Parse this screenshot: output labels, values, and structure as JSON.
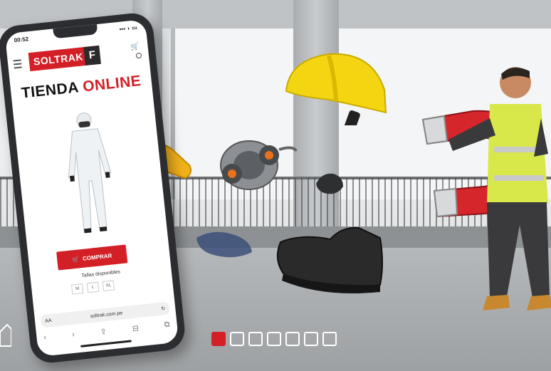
{
  "phone": {
    "time": "00:52",
    "signal": "▪▪▪ ◗ ▭",
    "brand": "SOLTRAK",
    "brand_mark": "F",
    "headline_part1": "TIENDA ",
    "headline_part2": "ONLINE",
    "buy_label": "COMPRAR",
    "sizes_label": "Tallas disponibles",
    "sizes": [
      "M",
      "L",
      "XL"
    ],
    "url_prefix": "AA",
    "url": "soltrak.com.pe",
    "toolbar": [
      "‹",
      "›",
      "⇪",
      "⊟",
      "⧉"
    ]
  },
  "colors": {
    "brand_red": "#d32027",
    "dark": "#2b2b2b"
  },
  "carousel": {
    "count": 7,
    "active_index": 0
  }
}
